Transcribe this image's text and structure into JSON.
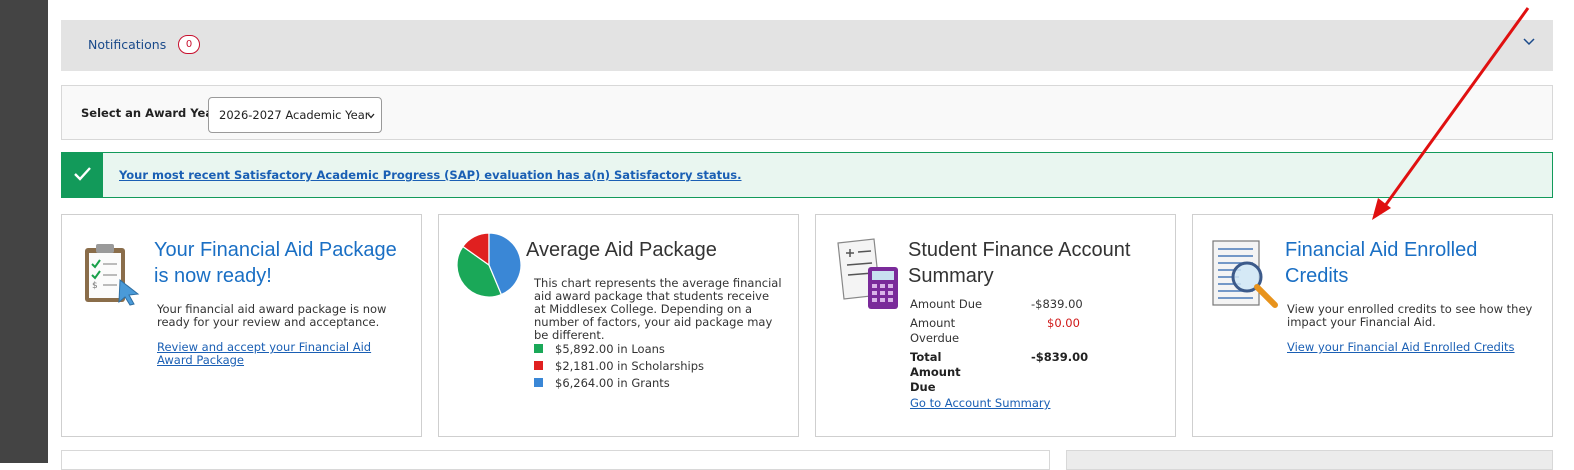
{
  "notifications": {
    "label": "Notifications",
    "count": "0"
  },
  "award_year": {
    "label": "Select an Award Year:",
    "selected": "2026-2027 Academic Year"
  },
  "sap": {
    "message": "Your most recent Satisfactory Academic Progress (SAP) evaluation has a(n) Satisfactory status."
  },
  "cards": {
    "package": {
      "title": "Your Financial Aid Package is now ready!",
      "text": "Your financial aid award package is now ready for your review and acceptance.",
      "link": "Review and accept your Financial Aid Award Package"
    },
    "average": {
      "title": "Average Aid Package",
      "text": "This chart represents the average financial aid award package that students receive at Middlesex College. Depending on a number of factors, your aid package may be different.",
      "legend": [
        {
          "label": "$5,892.00 in Loans",
          "color": "#1aa858"
        },
        {
          "label": "$2,181.00 in Scholarships",
          "color": "#e02020"
        },
        {
          "label": "$6,264.00 in Grants",
          "color": "#3a87d6"
        }
      ]
    },
    "finance": {
      "title": "Student Finance Account Summary",
      "rows": {
        "amount_due_label": "Amount Due",
        "amount_due_value": "-$839.00",
        "overdue_label": "Amount Overdue",
        "overdue_value": "$0.00",
        "total_label": "Total Amount Due",
        "total_value": "-$839.00"
      },
      "link": "Go to Account Summary"
    },
    "credits": {
      "title": "Financial Aid Enrolled Credits",
      "text": "View your enrolled credits to see how they impact your Financial Aid.",
      "link": "View your Financial Aid Enrolled Credits"
    }
  },
  "chart_data": {
    "type": "pie",
    "categories": [
      "Loans",
      "Scholarships",
      "Grants"
    ],
    "values": [
      5892.0,
      2181.0,
      6264.0
    ],
    "colors": [
      "#1aa858",
      "#e02020",
      "#3a87d6"
    ]
  },
  "icons": {
    "chevron": "chevron-down-icon",
    "check": "check-icon",
    "clipboard": "clipboard-icon",
    "calculator": "calculator-icon",
    "magnifier": "magnifying-glass-icon"
  }
}
